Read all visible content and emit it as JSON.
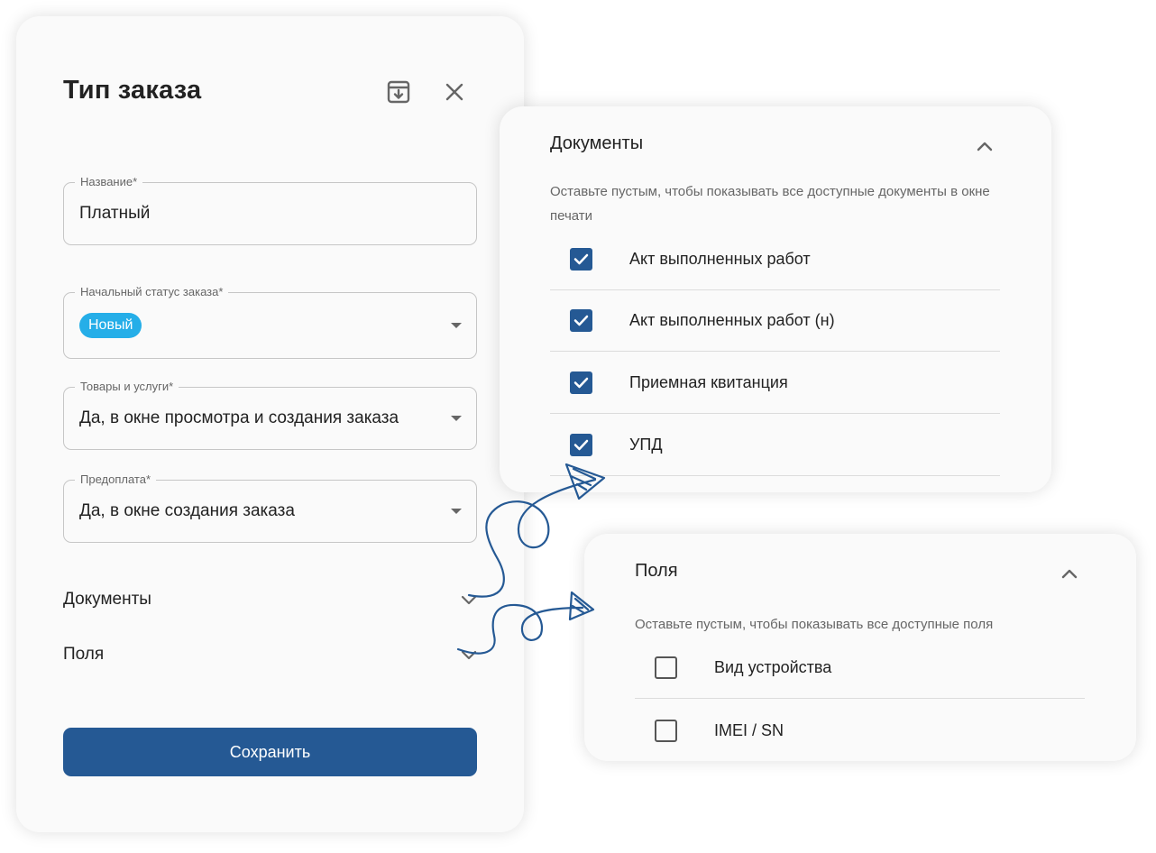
{
  "dialog": {
    "title": "Тип заказа",
    "fields": {
      "name": {
        "label": "Название*",
        "value": "Платный"
      },
      "status": {
        "label": "Начальный статус заказа*",
        "value": "Новый",
        "chip_color": "#25aee8"
      },
      "goods": {
        "label": "Товары и услуги*",
        "value": "Да, в окне просмотра и создания заказа"
      },
      "prepay": {
        "label": "Предоплата*",
        "value": "Да, в окне создания заказа"
      }
    },
    "sections": {
      "documents": "Документы",
      "fields": "Поля"
    },
    "save_label": "Сохранить",
    "accent_color": "#255994"
  },
  "documents_panel": {
    "title": "Документы",
    "hint": "Оставьте пустым, чтобы показывать все доступные документы в окне печати",
    "items": [
      {
        "label": "Акт выполненных работ",
        "checked": true
      },
      {
        "label": "Акт выполненных работ (н)",
        "checked": true
      },
      {
        "label": "Приемная квитанция",
        "checked": true
      },
      {
        "label": "УПД",
        "checked": true
      }
    ]
  },
  "fields_panel": {
    "title": "Поля",
    "hint": "Оставьте пустым, чтобы показывать все доступные поля",
    "items": [
      {
        "label": "Вид устройства",
        "checked": false
      },
      {
        "label": "IMEI / SN",
        "checked": false
      }
    ]
  },
  "icons": [
    "archive-download-icon",
    "close-icon",
    "chevron-down-icon",
    "chevron-up-icon",
    "check-icon",
    "hand-drawn-arrow"
  ]
}
